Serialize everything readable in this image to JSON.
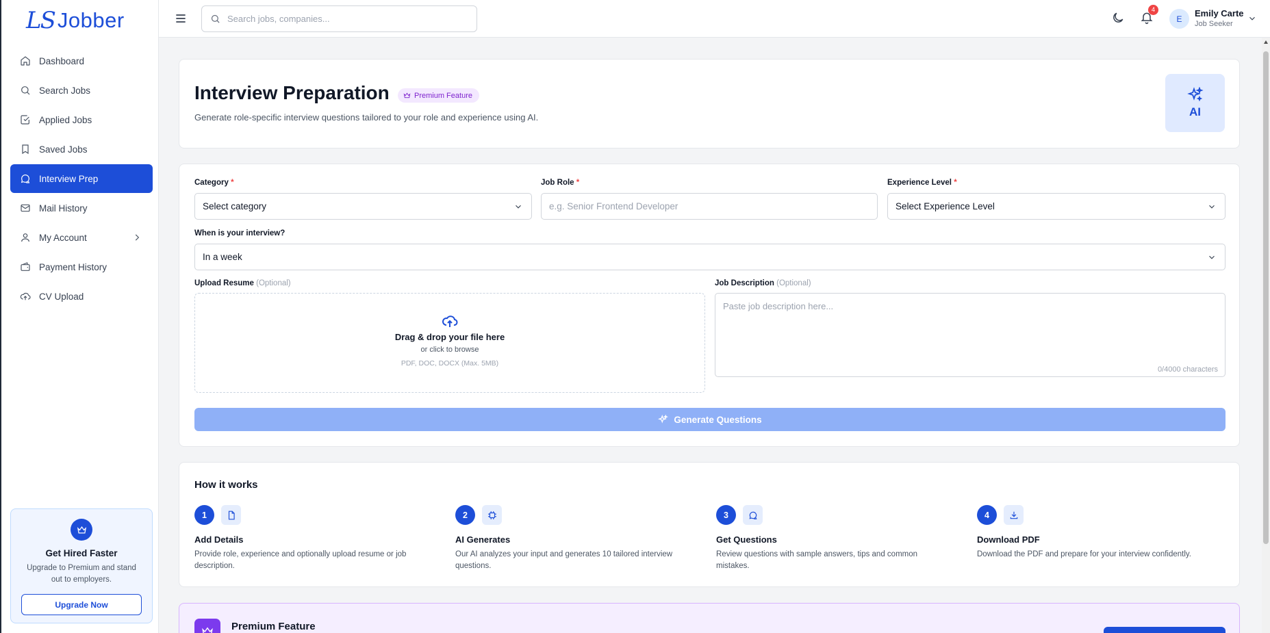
{
  "brand": {
    "logo_mark": "LS",
    "logo_text": "Jobber"
  },
  "sidebar": {
    "items": [
      {
        "label": "Dashboard",
        "icon": "home-icon"
      },
      {
        "label": "Search Jobs",
        "icon": "search-icon"
      },
      {
        "label": "Applied Jobs",
        "icon": "checkbox-icon"
      },
      {
        "label": "Saved Jobs",
        "icon": "bookmark-icon"
      },
      {
        "label": "Interview Prep",
        "icon": "chat-bubbles-icon",
        "active": true
      },
      {
        "label": "Mail History",
        "icon": "mail-icon"
      },
      {
        "label": "My Account",
        "icon": "user-icon"
      },
      {
        "label": "Payment History",
        "icon": "wallet-icon"
      },
      {
        "label": "CV Upload",
        "icon": "cloud-upload-icon"
      }
    ],
    "promo": {
      "title": "Get Hired Faster",
      "text": "Upgrade to Premium and stand out to employers.",
      "button": "Upgrade Now"
    }
  },
  "header": {
    "search_placeholder": "Search jobs, companies...",
    "notification_count": "4",
    "user": {
      "initial": "E",
      "name": "Emily Carte",
      "role": "Job Seeker"
    }
  },
  "hero": {
    "title": "Interview Preparation",
    "badge": "Premium Feature",
    "subtitle": "Generate role-specific interview questions tailored to your role and experience using AI.",
    "ai_label": "AI"
  },
  "form": {
    "category": {
      "label": "Category",
      "required_mark": "*",
      "value": "Select category"
    },
    "job_role": {
      "label": "Job Role",
      "required_mark": "*",
      "placeholder": "e.g. Senior Frontend Developer"
    },
    "experience": {
      "label": "Experience Level",
      "required_mark": "*",
      "value": "Select Experience Level"
    },
    "interview_when": {
      "label": "When is your interview?",
      "value": "In a week"
    },
    "resume": {
      "label": "Upload Resume",
      "optional": "(Optional)",
      "title": "Drag & drop your file here",
      "sub": "or click to browse",
      "types": "PDF, DOC, DOCX (Max. 5MB)"
    },
    "job_description": {
      "label": "Job Description",
      "optional": "(Optional)",
      "placeholder": "Paste job description here...",
      "counter": "0/4000 characters"
    },
    "generate_button": "Generate Questions"
  },
  "how_it_works": {
    "title": "How it works",
    "steps": [
      {
        "num": "1",
        "icon": "document-icon",
        "title": "Add Details",
        "text": "Provide role, experience and optionally upload resume or job description."
      },
      {
        "num": "2",
        "icon": "chip-icon",
        "title": "AI Generates",
        "text": "Our AI analyzes your input and generates 10 tailored interview questions."
      },
      {
        "num": "3",
        "icon": "chat-icon",
        "title": "Get Questions",
        "text": "Review questions with sample answers, tips and common mistakes."
      },
      {
        "num": "4",
        "icon": "download-icon",
        "title": "Download PDF",
        "text": "Download the PDF and prepare for your interview confidently."
      }
    ]
  },
  "premium_banner": {
    "title": "Premium Feature"
  },
  "colors": {
    "primary": "#1d4ed8",
    "premium": "#7c3aed",
    "badge": "#ef4444"
  }
}
